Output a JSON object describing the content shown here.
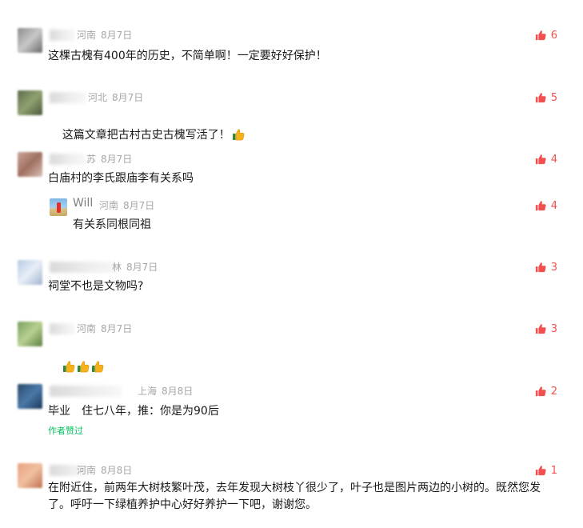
{
  "colors": {
    "like": "#f0504f",
    "meta": "#a6a6a6",
    "author_liked": "#07c160"
  },
  "comments": [
    {
      "region": "河南",
      "date": "8月7日",
      "likes": "6",
      "text": "这棵古槐有400年的历史，不简单啊！一定要好好保护！"
    },
    {
      "region": "河北",
      "date": "8月7日",
      "likes": "5",
      "text": "这篇文章把古村古史古槐写活了！",
      "emoji": "thumbs-up"
    },
    {
      "region": "苏",
      "date": "8月7日",
      "likes": "4",
      "text": "白庙村的李氏跟庙李有关系吗",
      "reply": {
        "name": "Will",
        "region": "河南",
        "date": "8月7日",
        "likes": "4",
        "text": "有关系同根同祖"
      }
    },
    {
      "region": "林",
      "date": "8月7日",
      "likes": "3",
      "text": "祠堂不也是文物吗?"
    },
    {
      "region": "河南",
      "date": "8月7日",
      "likes": "3",
      "text": "",
      "emoji": "thumbs-up x3"
    },
    {
      "region": "上海",
      "date": "8月8日",
      "likes": "2",
      "text": "毕业　住七八年，推：你是为90后",
      "author_liked": "作者赞过"
    },
    {
      "region": "河南",
      "date": "8月8日",
      "likes": "1",
      "text": "在附近住，前两年大树枝繁叶茂，去年发现大树枝丫很少了，叶子也是图片两边的小树的。既然您发了。呼吁一下绿植养护中心好好养护一下吧，谢谢您。"
    }
  ]
}
